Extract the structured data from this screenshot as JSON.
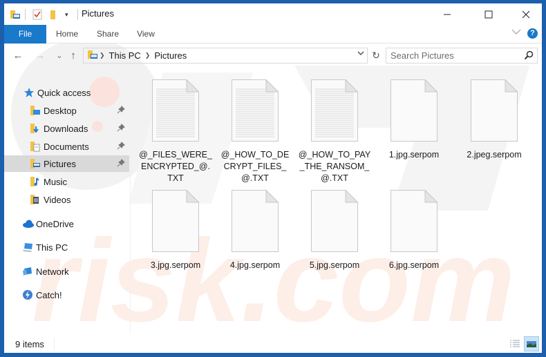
{
  "window": {
    "title": "Pictures",
    "controls": {
      "minimize": "—",
      "maximize": "☐",
      "close": "✕"
    }
  },
  "ribbon": {
    "tabs": [
      {
        "label": "File",
        "active": true
      },
      {
        "label": "Home"
      },
      {
        "label": "Share"
      },
      {
        "label": "View"
      }
    ],
    "help_label": "?"
  },
  "nav": {
    "back": "←",
    "forward": "→",
    "recent": "⌄",
    "up": "↑",
    "breadcrumb": [
      "This PC",
      "Pictures"
    ],
    "refresh": "↻",
    "search_placeholder": "Search Pictures"
  },
  "sidebar": {
    "items": [
      {
        "label": "Quick access",
        "icon": "star-icon",
        "level": 0
      },
      {
        "label": "Desktop",
        "icon": "desktop-folder-icon",
        "level": 1,
        "pinned": true
      },
      {
        "label": "Downloads",
        "icon": "downloads-folder-icon",
        "level": 1,
        "pinned": true
      },
      {
        "label": "Documents",
        "icon": "documents-folder-icon",
        "level": 1,
        "pinned": true
      },
      {
        "label": "Pictures",
        "icon": "pictures-folder-icon",
        "level": 1,
        "pinned": true,
        "selected": true
      },
      {
        "label": "Music",
        "icon": "music-folder-icon",
        "level": 1
      },
      {
        "label": "Videos",
        "icon": "videos-folder-icon",
        "level": 1
      },
      {
        "label": "OneDrive",
        "icon": "onedrive-icon",
        "level": 0
      },
      {
        "label": "This PC",
        "icon": "this-pc-icon",
        "level": 0
      },
      {
        "label": "Network",
        "icon": "network-icon",
        "level": 0
      },
      {
        "label": "Catch!",
        "icon": "catch-icon",
        "level": 0
      }
    ],
    "pin_glyph": "📌"
  },
  "files": [
    {
      "name": "@_FILES_WERE_ENCRYPTED_@.TXT",
      "type": "text"
    },
    {
      "name": "@_HOW_TO_DECRYPT_FILES_@.TXT",
      "type": "text"
    },
    {
      "name": "@_HOW_TO_PAY_THE_RANSOM_@.TXT",
      "type": "text"
    },
    {
      "name": "1.jpg.serpom",
      "type": "blank"
    },
    {
      "name": "2.jpeg.serpom",
      "type": "blank"
    },
    {
      "name": "3.jpg.serpom",
      "type": "blank"
    },
    {
      "name": "4.jpg.serpom",
      "type": "blank"
    },
    {
      "name": "5.jpg.serpom",
      "type": "blank"
    },
    {
      "name": "6.jpg.serpom",
      "type": "blank"
    }
  ],
  "status": {
    "item_count": "9 items"
  },
  "colors": {
    "accent": "#1979ca",
    "frame": "#1b5fad",
    "selection": "#d9d9d9"
  }
}
